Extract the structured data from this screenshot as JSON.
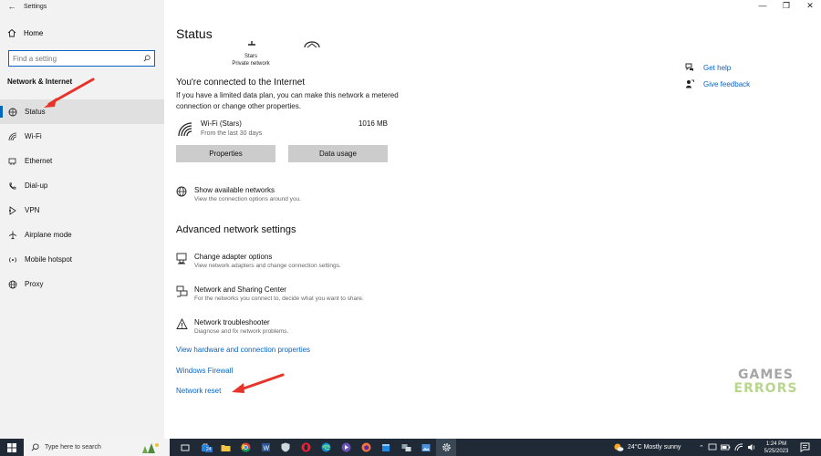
{
  "window": {
    "title": "Settings",
    "controls": [
      "—",
      "❐",
      "✕"
    ]
  },
  "sidebar": {
    "home_label": "Home",
    "search_placeholder": "Find a setting",
    "section_label": "Network & Internet",
    "items": [
      {
        "label": "Status",
        "icon": "status-icon",
        "active": true
      },
      {
        "label": "Wi-Fi",
        "icon": "wifi-icon"
      },
      {
        "label": "Ethernet",
        "icon": "ethernet-icon"
      },
      {
        "label": "Dial-up",
        "icon": "dialup-icon"
      },
      {
        "label": "VPN",
        "icon": "vpn-icon"
      },
      {
        "label": "Airplane mode",
        "icon": "airplane-icon"
      },
      {
        "label": "Mobile hotspot",
        "icon": "hotspot-icon"
      },
      {
        "label": "Proxy",
        "icon": "globe-icon"
      }
    ]
  },
  "main": {
    "title": "Status",
    "network_diagram": {
      "name": "Stars",
      "type": "Private network"
    },
    "connected_heading": "You're connected to the Internet",
    "connected_desc": "If you have a limited data plan, you can make this network a metered connection or change other properties.",
    "wifi": {
      "name": "Wi-Fi (Stars)",
      "sub": "From the last 30 days",
      "size": "1016 MB"
    },
    "buttons": {
      "properties": "Properties",
      "data_usage": "Data usage"
    },
    "show_networks": {
      "title": "Show available networks",
      "sub": "View the connection options around you."
    },
    "advanced_heading": "Advanced network settings",
    "adapter": {
      "title": "Change adapter options",
      "sub": "View network adapters and change connection settings."
    },
    "sharing": {
      "title": "Network and Sharing Center",
      "sub": "For the networks you connect to, decide what you want to share."
    },
    "troubleshooter": {
      "title": "Network troubleshooter",
      "sub": "Diagnose and fix network problems."
    },
    "links": {
      "hardware": "View hardware and connection properties",
      "firewall": "Windows Firewall",
      "reset": "Network reset"
    }
  },
  "help": {
    "get_help": "Get help",
    "feedback": "Give feedback"
  },
  "watermark": {
    "line1": "GAMES",
    "line2": "ERRORS"
  },
  "taskbar": {
    "search_placeholder": "Type here to search",
    "badge": "24",
    "weather": "24°C  Mostly sunny",
    "time": "1:24 PM",
    "date": "5/25/2023"
  },
  "colors": {
    "accent": "#0067c0",
    "link": "#0a63c2",
    "annotation_arrow": "#e8332a",
    "taskbar": "#1f2a36"
  }
}
